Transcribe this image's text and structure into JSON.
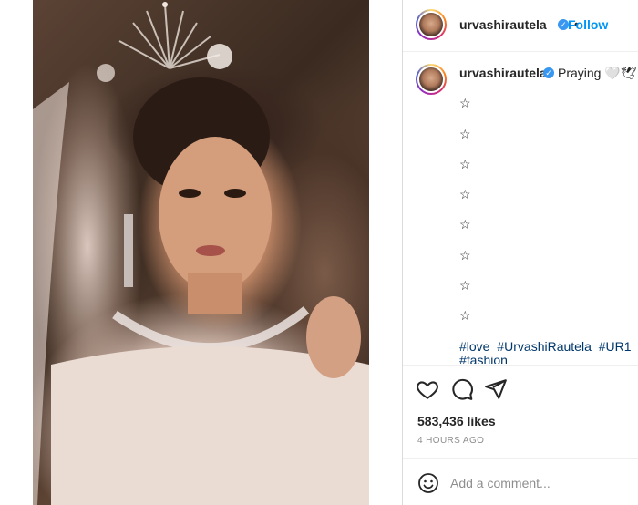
{
  "post": {
    "username": "urvashirautela",
    "follow_label": "Follow",
    "separator": "•"
  },
  "caption": {
    "username": "urvashirautela",
    "text": "Praying 🤍🕊",
    "stars": [
      "☆",
      "☆",
      "☆",
      "☆",
      "☆",
      "☆",
      "☆",
      "☆"
    ],
    "hashtags": [
      "#love",
      "#UrvashiRautela",
      "#UR1"
    ],
    "cut_text": "#fashion"
  },
  "actions": {
    "icons": [
      "heart-icon",
      "comment-icon",
      "share-icon"
    ]
  },
  "stats": {
    "likes": "583,436 likes",
    "time": "4 HOURS AGO"
  },
  "comment": {
    "placeholder": "Add a comment..."
  },
  "colors": {
    "accent": "#0095f6",
    "verified": "#3897f0",
    "hashtag": "#00376b",
    "muted": "#8e8e8e"
  }
}
